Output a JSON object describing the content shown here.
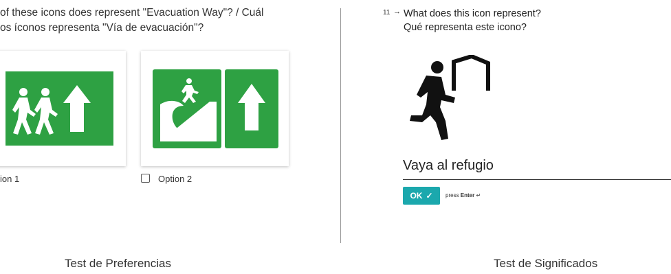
{
  "left_panel": {
    "question_line1": "of these icons does represent \"Evacuation Way\"? / Cuál",
    "question_line2": "os íconos representa \"Vía de evacuación\"?",
    "option1_label": "ion 1",
    "option2_label": "Option 2",
    "option1_icon": "running-people-arrow-up-icon",
    "option2_icon": "running-person-wave-arrow-up-icon",
    "option2_checked": false,
    "sign_color": "#2ea143"
  },
  "right_panel": {
    "question_number": "11",
    "question_line1": "What does this icon represent?",
    "question_line2": "Qué representa este icono?",
    "icon": "person-running-to-shelter-icon",
    "answer_value": "Vaya al refugio",
    "ok_label": "OK",
    "press_text": "press",
    "press_key": "Enter",
    "accent_color": "#1ba8ad"
  },
  "captions": {
    "left": "Test de Preferencias",
    "right": "Test de Significados"
  }
}
